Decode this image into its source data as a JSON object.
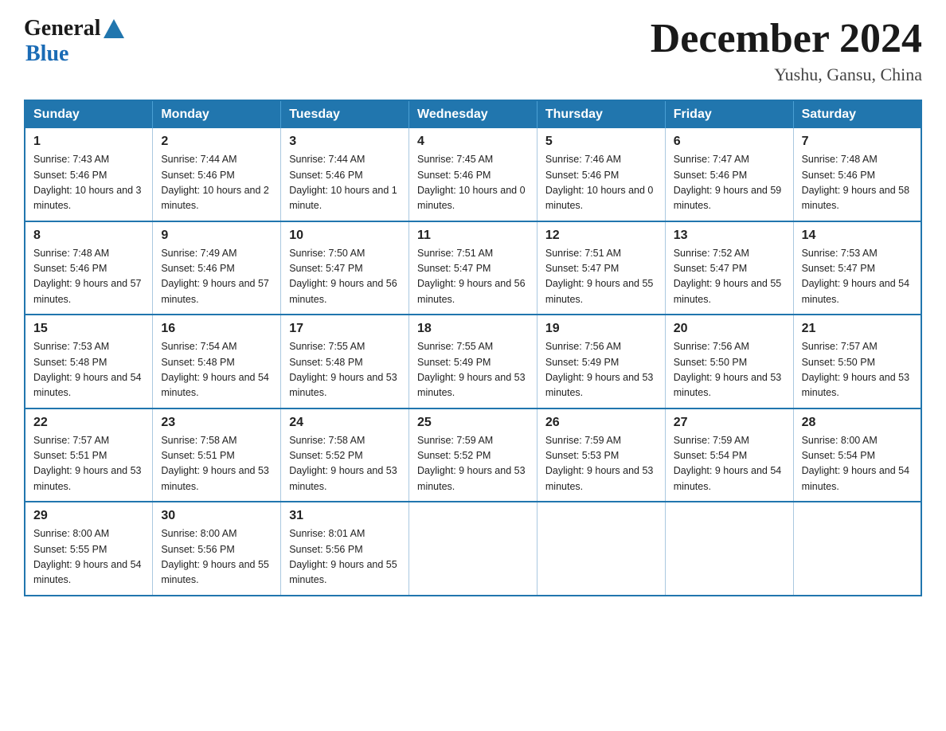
{
  "header": {
    "logo": {
      "line1": "General",
      "line2": "Blue"
    },
    "title": "December 2024",
    "location": "Yushu, Gansu, China"
  },
  "days_of_week": [
    "Sunday",
    "Monday",
    "Tuesday",
    "Wednesday",
    "Thursday",
    "Friday",
    "Saturday"
  ],
  "weeks": [
    [
      {
        "day": "1",
        "sunrise": "7:43 AM",
        "sunset": "5:46 PM",
        "daylight": "10 hours and 3 minutes."
      },
      {
        "day": "2",
        "sunrise": "7:44 AM",
        "sunset": "5:46 PM",
        "daylight": "10 hours and 2 minutes."
      },
      {
        "day": "3",
        "sunrise": "7:44 AM",
        "sunset": "5:46 PM",
        "daylight": "10 hours and 1 minute."
      },
      {
        "day": "4",
        "sunrise": "7:45 AM",
        "sunset": "5:46 PM",
        "daylight": "10 hours and 0 minutes."
      },
      {
        "day": "5",
        "sunrise": "7:46 AM",
        "sunset": "5:46 PM",
        "daylight": "10 hours and 0 minutes."
      },
      {
        "day": "6",
        "sunrise": "7:47 AM",
        "sunset": "5:46 PM",
        "daylight": "9 hours and 59 minutes."
      },
      {
        "day": "7",
        "sunrise": "7:48 AM",
        "sunset": "5:46 PM",
        "daylight": "9 hours and 58 minutes."
      }
    ],
    [
      {
        "day": "8",
        "sunrise": "7:48 AM",
        "sunset": "5:46 PM",
        "daylight": "9 hours and 57 minutes."
      },
      {
        "day": "9",
        "sunrise": "7:49 AM",
        "sunset": "5:46 PM",
        "daylight": "9 hours and 57 minutes."
      },
      {
        "day": "10",
        "sunrise": "7:50 AM",
        "sunset": "5:47 PM",
        "daylight": "9 hours and 56 minutes."
      },
      {
        "day": "11",
        "sunrise": "7:51 AM",
        "sunset": "5:47 PM",
        "daylight": "9 hours and 56 minutes."
      },
      {
        "day": "12",
        "sunrise": "7:51 AM",
        "sunset": "5:47 PM",
        "daylight": "9 hours and 55 minutes."
      },
      {
        "day": "13",
        "sunrise": "7:52 AM",
        "sunset": "5:47 PM",
        "daylight": "9 hours and 55 minutes."
      },
      {
        "day": "14",
        "sunrise": "7:53 AM",
        "sunset": "5:47 PM",
        "daylight": "9 hours and 54 minutes."
      }
    ],
    [
      {
        "day": "15",
        "sunrise": "7:53 AM",
        "sunset": "5:48 PM",
        "daylight": "9 hours and 54 minutes."
      },
      {
        "day": "16",
        "sunrise": "7:54 AM",
        "sunset": "5:48 PM",
        "daylight": "9 hours and 54 minutes."
      },
      {
        "day": "17",
        "sunrise": "7:55 AM",
        "sunset": "5:48 PM",
        "daylight": "9 hours and 53 minutes."
      },
      {
        "day": "18",
        "sunrise": "7:55 AM",
        "sunset": "5:49 PM",
        "daylight": "9 hours and 53 minutes."
      },
      {
        "day": "19",
        "sunrise": "7:56 AM",
        "sunset": "5:49 PM",
        "daylight": "9 hours and 53 minutes."
      },
      {
        "day": "20",
        "sunrise": "7:56 AM",
        "sunset": "5:50 PM",
        "daylight": "9 hours and 53 minutes."
      },
      {
        "day": "21",
        "sunrise": "7:57 AM",
        "sunset": "5:50 PM",
        "daylight": "9 hours and 53 minutes."
      }
    ],
    [
      {
        "day": "22",
        "sunrise": "7:57 AM",
        "sunset": "5:51 PM",
        "daylight": "9 hours and 53 minutes."
      },
      {
        "day": "23",
        "sunrise": "7:58 AM",
        "sunset": "5:51 PM",
        "daylight": "9 hours and 53 minutes."
      },
      {
        "day": "24",
        "sunrise": "7:58 AM",
        "sunset": "5:52 PM",
        "daylight": "9 hours and 53 minutes."
      },
      {
        "day": "25",
        "sunrise": "7:59 AM",
        "sunset": "5:52 PM",
        "daylight": "9 hours and 53 minutes."
      },
      {
        "day": "26",
        "sunrise": "7:59 AM",
        "sunset": "5:53 PM",
        "daylight": "9 hours and 53 minutes."
      },
      {
        "day": "27",
        "sunrise": "7:59 AM",
        "sunset": "5:54 PM",
        "daylight": "9 hours and 54 minutes."
      },
      {
        "day": "28",
        "sunrise": "8:00 AM",
        "sunset": "5:54 PM",
        "daylight": "9 hours and 54 minutes."
      }
    ],
    [
      {
        "day": "29",
        "sunrise": "8:00 AM",
        "sunset": "5:55 PM",
        "daylight": "9 hours and 54 minutes."
      },
      {
        "day": "30",
        "sunrise": "8:00 AM",
        "sunset": "5:56 PM",
        "daylight": "9 hours and 55 minutes."
      },
      {
        "day": "31",
        "sunrise": "8:01 AM",
        "sunset": "5:56 PM",
        "daylight": "9 hours and 55 minutes."
      },
      null,
      null,
      null,
      null
    ]
  ],
  "labels": {
    "sunrise": "Sunrise:",
    "sunset": "Sunset:",
    "daylight": "Daylight:"
  }
}
